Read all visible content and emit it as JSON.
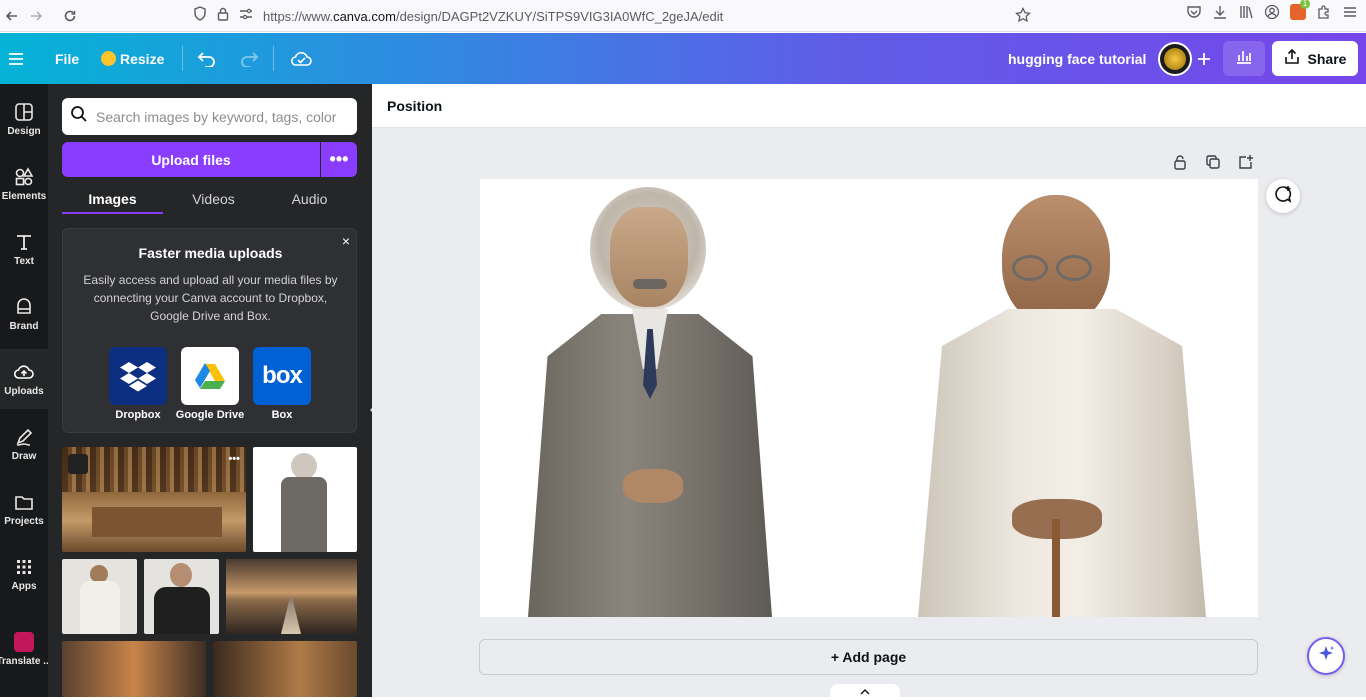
{
  "browser": {
    "url_prefix": "https://www.",
    "url_domain": "canva.com",
    "url_path": "/design/DAGPt2VZKUY/SiTPS9VIG3IA0WfC_2geJA/edit",
    "notification_badge": "1"
  },
  "topbar": {
    "file_label": "File",
    "resize_label": "Resize",
    "design_title": "hugging face tutorial",
    "share_label": "Share"
  },
  "rail": {
    "items": [
      {
        "label": "Design"
      },
      {
        "label": "Elements"
      },
      {
        "label": "Text"
      },
      {
        "label": "Brand"
      },
      {
        "label": "Uploads"
      },
      {
        "label": "Draw"
      },
      {
        "label": "Projects"
      },
      {
        "label": "Apps"
      },
      {
        "label": "Translate ..."
      }
    ]
  },
  "panel": {
    "search_placeholder": "Search images by keyword, tags, color...",
    "upload_label": "Upload files",
    "more_label": "•••",
    "tabs": [
      {
        "label": "Images"
      },
      {
        "label": "Videos"
      },
      {
        "label": "Audio"
      }
    ],
    "promo": {
      "title": "Faster media uploads",
      "body": "Easily access and upload all your media files by connecting your Canva account to Dropbox, Google Drive and Box.",
      "close": "×",
      "services": [
        {
          "label": "Dropbox",
          "color": "#0d2f81"
        },
        {
          "label": "Google Drive",
          "color": "#ffffff"
        },
        {
          "label": "Box",
          "color": "#0061d5"
        }
      ]
    }
  },
  "workspace": {
    "context_label": "Position",
    "add_page_label": "+ Add page"
  },
  "colors": {
    "accent": "#8b3dff",
    "panel_bg": "#252627",
    "rail_bg": "#18191b"
  }
}
